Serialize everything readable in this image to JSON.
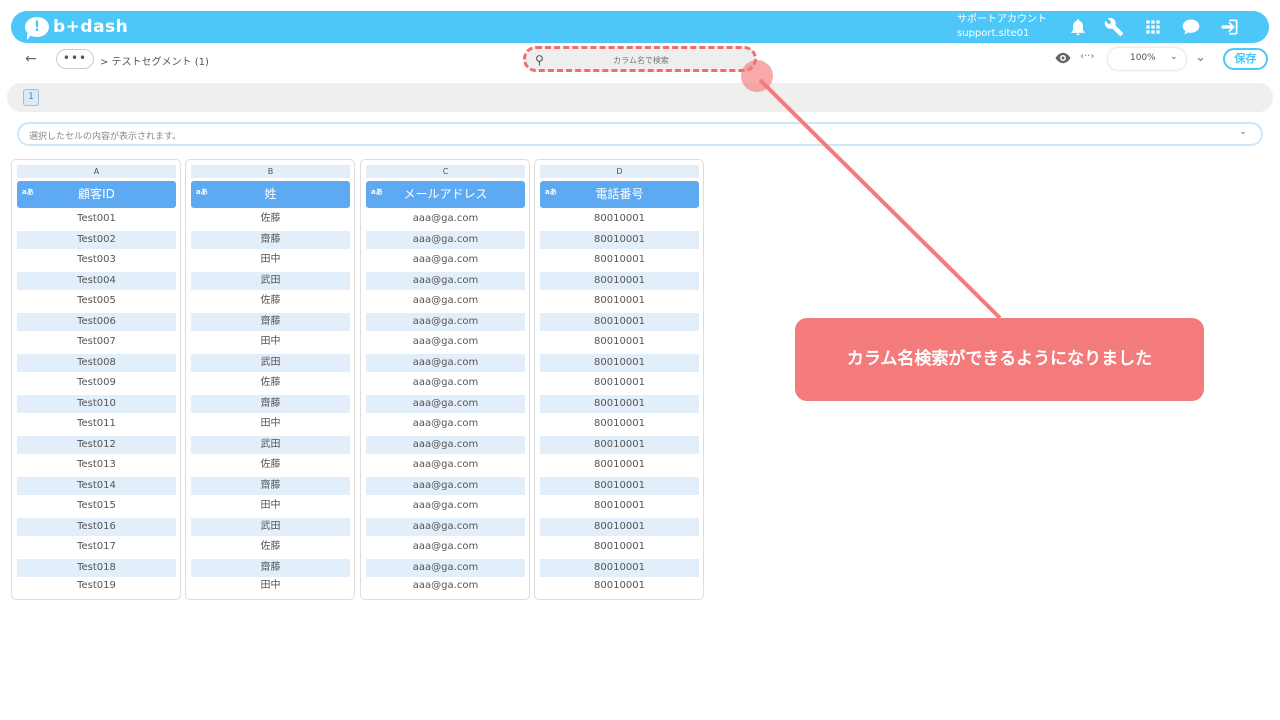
{
  "app": {
    "logo_text": "b+dash",
    "logo_mark": "!"
  },
  "account": {
    "label": "サポートアカウント",
    "site": "support.site01"
  },
  "subbar": {
    "back_icon": "←",
    "more_label": "•••",
    "breadcrumb": "> テストセグメント (1)",
    "search_placeholder": "カラム名で検索",
    "arrows_label": "‹··›",
    "zoom": "100%",
    "save_label": "保存"
  },
  "pager": {
    "page": "1"
  },
  "cell_viewer": {
    "placeholder": "選択したセルの内容が表示されます。"
  },
  "columns": [
    {
      "letter": "A",
      "type": "aあ",
      "name": "顧客ID",
      "rows": [
        "Test001",
        "Test002",
        "Test003",
        "Test004",
        "Test005",
        "Test006",
        "Test007",
        "Test008",
        "Test009",
        "Test010",
        "Test011",
        "Test012",
        "Test013",
        "Test014",
        "Test015",
        "Test016",
        "Test017",
        "Test018",
        "Test019"
      ]
    },
    {
      "letter": "B",
      "type": "aあ",
      "name": "姓",
      "rows": [
        "佐藤",
        "齋藤",
        "田中",
        "武田",
        "佐藤",
        "齋藤",
        "田中",
        "武田",
        "佐藤",
        "齋藤",
        "田中",
        "武田",
        "佐藤",
        "齋藤",
        "田中",
        "武田",
        "佐藤",
        "齋藤",
        "田中"
      ]
    },
    {
      "letter": "C",
      "type": "aあ",
      "name": "メールアドレス",
      "rows": [
        "aaa@ga.com",
        "aaa@ga.com",
        "aaa@ga.com",
        "aaa@ga.com",
        "aaa@ga.com",
        "aaa@ga.com",
        "aaa@ga.com",
        "aaa@ga.com",
        "aaa@ga.com",
        "aaa@ga.com",
        "aaa@ga.com",
        "aaa@ga.com",
        "aaa@ga.com",
        "aaa@ga.com",
        "aaa@ga.com",
        "aaa@ga.com",
        "aaa@ga.com",
        "aaa@ga.com",
        "aaa@ga.com"
      ]
    },
    {
      "letter": "D",
      "type": "aあ",
      "name": "電話番号",
      "rows": [
        "80010001",
        "80010001",
        "80010001",
        "80010001",
        "80010001",
        "80010001",
        "80010001",
        "80010001",
        "80010001",
        "80010001",
        "80010001",
        "80010001",
        "80010001",
        "80010001",
        "80010001",
        "80010001",
        "80010001",
        "80010001",
        "80010001"
      ]
    }
  ],
  "callout": {
    "text": "カラム名検索ができるようになりました"
  },
  "colors": {
    "brand": "#4cc7f7",
    "header_blue": "#5eaaf2",
    "accent_red": "#f47b7c"
  }
}
